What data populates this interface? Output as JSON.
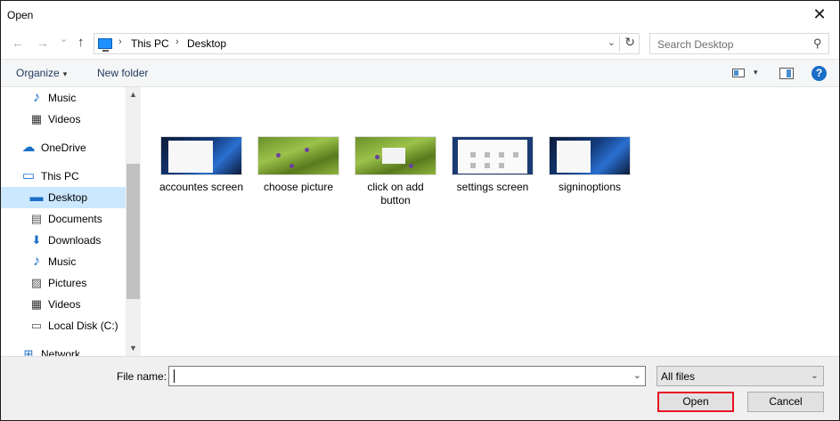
{
  "window": {
    "title": "Open",
    "close_glyph": "✕"
  },
  "navigation": {
    "back_glyph": "←",
    "forward_glyph": "→",
    "recent_glyph": "⌄",
    "up_glyph": "↑",
    "address": {
      "crumbs": [
        "This PC",
        "Desktop"
      ],
      "separator": "›",
      "dropdown_glyph": "⌄",
      "refresh_glyph": "↻"
    },
    "search": {
      "placeholder": "Search Desktop",
      "icon": "search-icon",
      "icon_glyph": "⚲"
    }
  },
  "toolbar": {
    "organize_label": "Organize",
    "caret_glyph": "▾",
    "new_folder_label": "New folder",
    "view_dropdown_glyph": "▾",
    "help_label": "?"
  },
  "sidebar": {
    "items": [
      {
        "label": "Music",
        "icon": "music-icon",
        "glyph": "♪"
      },
      {
        "label": "Videos",
        "icon": "videos-icon",
        "glyph": "▦"
      },
      {
        "label": "OneDrive",
        "icon": "onedrive-icon",
        "glyph": "☁"
      },
      {
        "label": "This PC",
        "icon": "computer-icon",
        "glyph": "▭"
      },
      {
        "label": "Desktop",
        "icon": "desktop-icon",
        "glyph": "▬",
        "selected": true
      },
      {
        "label": "Documents",
        "icon": "documents-icon",
        "glyph": "▤"
      },
      {
        "label": "Downloads",
        "icon": "downloads-icon",
        "glyph": "⬇"
      },
      {
        "label": "Music",
        "icon": "music-icon",
        "glyph": "♪"
      },
      {
        "label": "Pictures",
        "icon": "pictures-icon",
        "glyph": "▨"
      },
      {
        "label": "Videos",
        "icon": "videos-icon",
        "glyph": "▦"
      },
      {
        "label": "Local Disk (C:)",
        "icon": "disk-icon",
        "glyph": "▭"
      },
      {
        "label": "Network",
        "icon": "network-icon",
        "glyph": "⊞"
      }
    ],
    "scroll_up_glyph": "▲",
    "scroll_down_glyph": "▼"
  },
  "files": [
    {
      "name": "accountes screen",
      "thumb": "windows-desktop"
    },
    {
      "name": "choose picture",
      "thumb": "grass-flowers"
    },
    {
      "name": "click on add button",
      "thumb": "grass-flowers-dialog"
    },
    {
      "name": "settings screen",
      "thumb": "settings"
    },
    {
      "name": "signinoptions",
      "thumb": "windows-desktop"
    }
  ],
  "footer": {
    "file_name_label": "File name:",
    "file_name_value": "",
    "dropdown_glyph": "⌄",
    "filter_value": "All files",
    "open_label": "Open",
    "cancel_label": "Cancel"
  },
  "colors": {
    "selection": "#cce8ff",
    "highlight_border": "#e81123",
    "link": "#1e395b",
    "help": "#1a6ec7"
  }
}
